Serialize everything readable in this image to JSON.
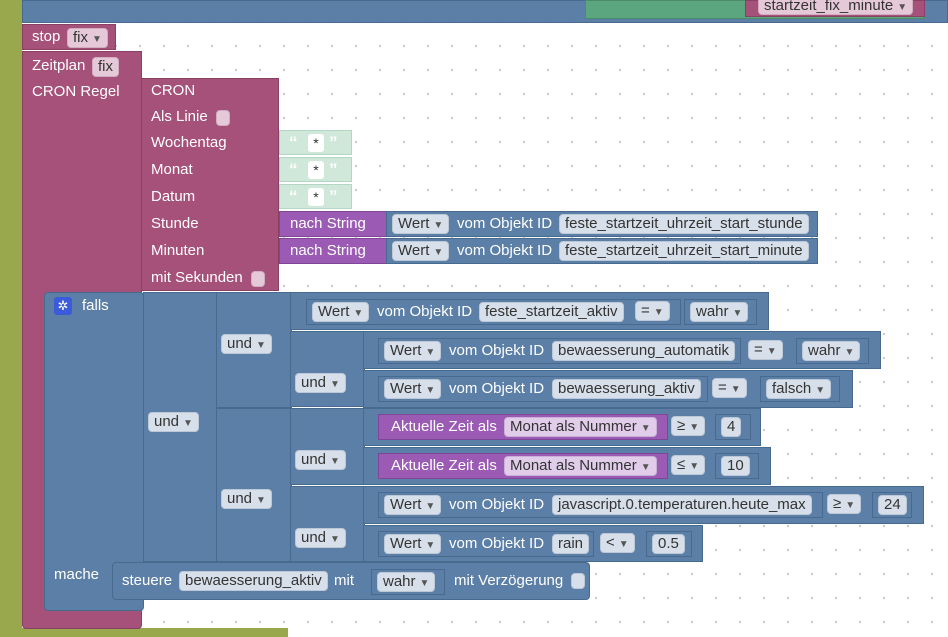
{
  "top": {
    "startzeit_field": "startzeit_fix_minute"
  },
  "stop": {
    "label": "stop",
    "value": "fix"
  },
  "zeitplan": {
    "label": "Zeitplan",
    "value": "fix"
  },
  "cron": {
    "rule_label": "CRON Regel",
    "title": "CRON",
    "als_linie": "Als Linie",
    "wochentag": "Wochentag",
    "monat": "Monat",
    "datum": "Datum",
    "stunde": "Stunde",
    "minuten": "Minuten",
    "mit_sekunden": "mit Sekunden",
    "star": "*",
    "nach_string": "nach String",
    "wert": "Wert",
    "vom_objekt": "vom Objekt ID",
    "stunde_id": "feste_startzeit_uhrzeit_start_stunde",
    "minute_id": "feste_startzeit_uhrzeit_start_minute"
  },
  "falls": {
    "label": "falls",
    "mache": "mache",
    "und": "und",
    "cond1": {
      "wert": "Wert",
      "vom": "vom Objekt ID",
      "id": "feste_startzeit_aktiv",
      "op": "=",
      "val": "wahr"
    },
    "cond2": {
      "wert": "Wert",
      "vom": "vom Objekt ID",
      "id": "bewaesserung_automatik",
      "op": "=",
      "val": "wahr"
    },
    "cond3": {
      "wert": "Wert",
      "vom": "vom Objekt ID",
      "id": "bewaesserung_aktiv",
      "op": "=",
      "val": "falsch"
    },
    "cond4": {
      "label": "Aktuelle Zeit als",
      "mode": "Monat als Nummer",
      "op": "≥",
      "val": "4"
    },
    "cond5": {
      "label": "Aktuelle Zeit als",
      "mode": "Monat als Nummer",
      "op": "≤",
      "val": "10"
    },
    "cond6": {
      "wert": "Wert",
      "vom": "vom Objekt ID",
      "id": "javascript.0.temperaturen.heute_max",
      "op": "≥",
      "val": "24"
    },
    "cond7": {
      "wert": "Wert",
      "vom": "vom Objekt ID",
      "id": "rain",
      "op": "<",
      "val": "0.5"
    },
    "action": {
      "label": "steuere",
      "target": "bewaesserung_aktiv",
      "mit": "mit",
      "val": "wahr",
      "delay": "mit Verzögerung"
    }
  }
}
